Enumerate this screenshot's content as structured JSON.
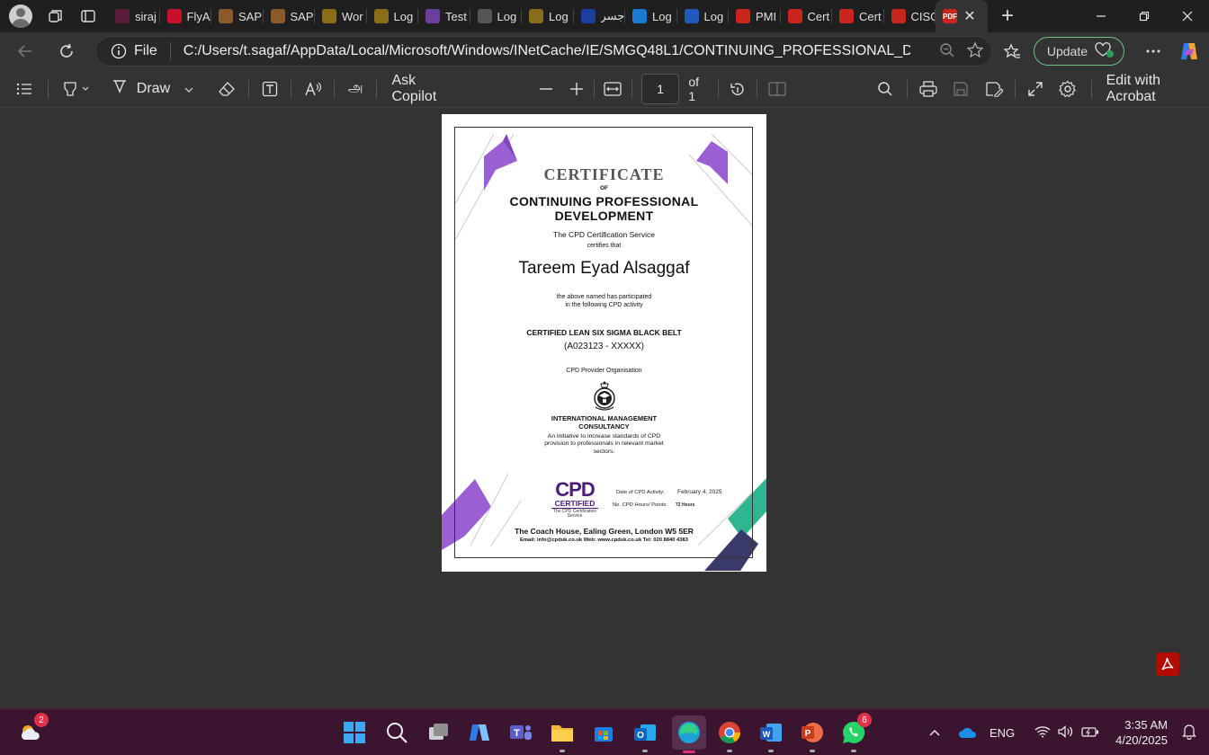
{
  "browser": {
    "tabs": [
      {
        "title": "siraj",
        "color": "#5a1a3a"
      },
      {
        "title": "FlyA",
        "color": "#c8102e"
      },
      {
        "title": "SAP",
        "color": "#8b5a2b"
      },
      {
        "title": "SAP",
        "color": "#8b5a2b"
      },
      {
        "title": "Wor",
        "color": "#8a6d1a"
      },
      {
        "title": "Log",
        "color": "#8a6d1a"
      },
      {
        "title": "Test",
        "color": "#6b3fa0"
      },
      {
        "title": "Log",
        "color": "#555555"
      },
      {
        "title": "Log",
        "color": "#8a6d1a"
      },
      {
        "title": "جسر",
        "color": "#1a3fa0"
      },
      {
        "title": "Log",
        "color": "#1a7ad4"
      },
      {
        "title": "Log",
        "color": "#1e5bb8"
      },
      {
        "title": "PMI",
        "color": "#c9271e"
      },
      {
        "title": "Cert",
        "color": "#c9271e"
      },
      {
        "title": "Cert",
        "color": "#c9271e"
      },
      {
        "title": "CISC",
        "color": "#c9271e"
      }
    ],
    "active_tab_icon": "pdf-icon",
    "address": {
      "site_info": "File",
      "url": "C:/Users/t.sagaf/AppData/Local/Microsoft/Windows/INetCache/IE/SMGQ48L1/CONTINUING_PROFESSIONAL_DEVELOPME..."
    },
    "update_label": "Update"
  },
  "pdf_toolbar": {
    "draw_label": "Draw",
    "copilot_label": "Ask Copilot",
    "page_current": "1",
    "page_total": "of 1",
    "edit_label": "Edit with Acrobat"
  },
  "certificate": {
    "heading": "CERTIFICATE",
    "of": "OF",
    "title_line1": "CONTINUING PROFESSIONAL",
    "title_line2": "DEVELOPMENT",
    "issuer": "The CPD Certification Service",
    "certifies": "certifies that",
    "name": "Tareem Eyad Alsaggaf",
    "participated_line1": "the above named has participated",
    "participated_line2": "in the following CPD activity",
    "activity": "CERTIFIED LEAN SIX SIGMA BLACK BELT",
    "code": "(A023123 - XXXXX)",
    "provider_label": "CPD Provider Organisation",
    "provider_line1": "INTERNATIONAL MANAGEMENT",
    "provider_line2": "CONSULTANCY",
    "initiative_line1": "An initiative to increase standards of CPD",
    "initiative_line2": "provision to professionals in relevant market",
    "initiative_line3": "sectors.",
    "cpd_logo_main": "CPD",
    "cpd_logo_sub": "CERTIFIED",
    "cpd_logo_caption": "The CPD Certification",
    "cpd_logo_caption2": "Service",
    "date_label": "Date of CPD Activity:",
    "date_value": "February 4, 2025",
    "hours_label": "No. CPD Hours/ Points:",
    "hours_value": "72 Hours",
    "address": "The Coach House, Ealing Green, London W5 5ER",
    "contact": "Email: info@cpduk.co.uk Web: www.cpduk.co.uk Tel: 020 8840 4383",
    "colors": {
      "purple": "#9b5fd4",
      "teal": "#2fb58f",
      "navy": "#3a3a6a"
    }
  },
  "taskbar": {
    "weather_badge": "2",
    "whatsapp_badge": "6",
    "language": "ENG",
    "time": "3:35 AM",
    "date": "4/20/2025",
    "accent": "#3b1530"
  }
}
